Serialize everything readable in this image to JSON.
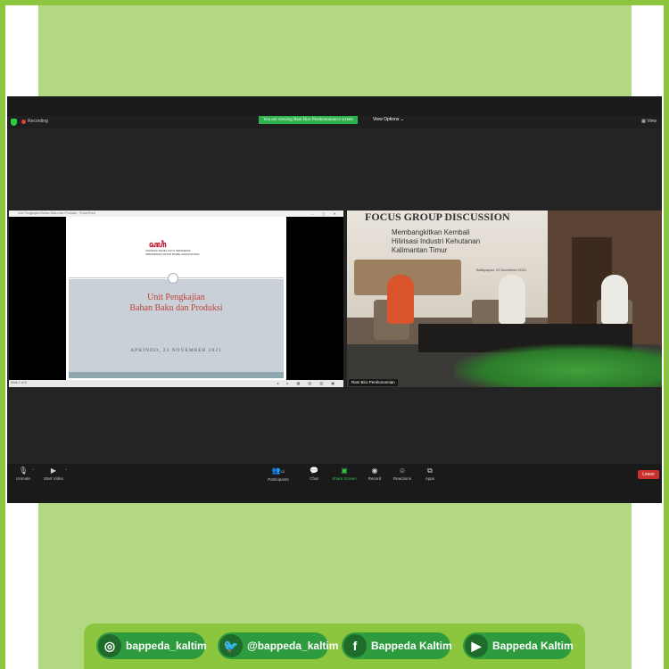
{
  "zoom": {
    "recording_label": "Recording",
    "viewing_banner": "You are viewing Rani Biro Perekonomian's screen",
    "view_options_label": "View Options",
    "view_button_label": "View"
  },
  "shared_screen": {
    "title_text": "Unit Pengkajian Bahan Baku dan Produksi - PowerPoint",
    "window_controls": "– ▢ ✕",
    "slide": {
      "logo_mark": "ꦱꦲꦶ",
      "logo_line1": "ASOSIASI PANEL KAYU INDONESIA",
      "logo_line2": "INDONESIAN WOOD PANEL ASSOCIATION",
      "heading_line1": "Unit Pengkajian",
      "heading_line2": "Bahan Baku dan Produksi",
      "date_line": "APKINDO, 23 NOVEMBER 2021"
    },
    "status_left": "Slide 1 of 6",
    "status_right": "◂ ▸ ▦ ▤ ▥ ▣"
  },
  "video_tile": {
    "banner_title": "FOCUS GROUP DISCUSSION",
    "banner_line1": "Membangkitkan Kembali",
    "banner_line2": "Hilirisasi Industri Kehutanan",
    "banner_line3": "Kalimantan Timur",
    "banner_date": "Balikpapan, 23 November 2021",
    "participant_name": "Rani Biro Perekonomian"
  },
  "toolbar": {
    "unmute_label": "Unmute",
    "start_video_label": "Start Video",
    "participants_label": "Participants",
    "participants_count": "12",
    "chat_label": "Chat",
    "share_screen_label": "Share Screen",
    "record_label": "Record",
    "reactions_label": "Reactions",
    "apps_label": "Apps",
    "leave_label": "Leave"
  },
  "social": {
    "instagram": "bappeda_kaltim",
    "twitter": "@bappeda_kaltim",
    "facebook": "Bappeda Kaltim",
    "youtube": "Bappeda Kaltim"
  },
  "colors": {
    "frame_green": "#8cc63f",
    "panel_green": "#b3d882",
    "pill_green": "#2e9b3e",
    "zoom_bg": "#242424",
    "leave_red": "#c9302c",
    "share_green": "#2fb24d"
  }
}
